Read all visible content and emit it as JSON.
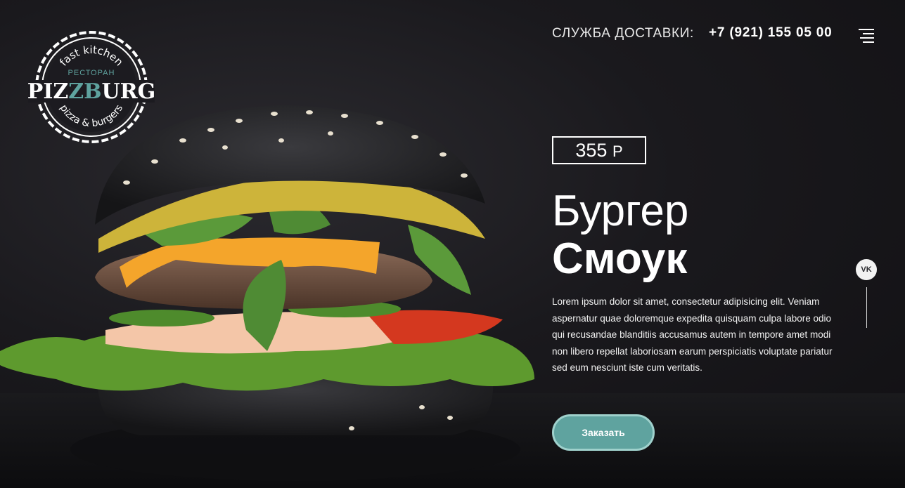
{
  "logo": {
    "top_text": "fast kitchen",
    "sub_text": "РЕСТОРАН",
    "brand_left": "PIZ",
    "brand_mid": "ZB",
    "brand_right": "URG",
    "bottom_text": "pizza & burgers"
  },
  "header": {
    "delivery_label": "СЛУЖБА ДОСТАВКИ:",
    "phone": "+7 (921) 155 05 00",
    "menu_icon": "hamburger-menu-icon"
  },
  "product": {
    "price_value": "355",
    "price_currency": "Р",
    "title_line1": "Бургер",
    "title_line2": "Смоук",
    "description": "Lorem ipsum dolor sit amet, consectetur adipisicing elit. Veniam aspernatur quae doloremque expedita quisquam culpa labore odio qui recusandae blanditiis accusamus autem in tempore amet modi non libero repellat laboriosam earum perspiciatis voluptate pariatur sed eum nesciunt iste cum veritatis.",
    "order_button": "Заказать"
  },
  "social": {
    "vk_label": "VK",
    "vk_icon": "vk-icon"
  },
  "colors": {
    "accent": "#5fa39f",
    "accent_border": "#9fd1cc",
    "background": "#1a191d"
  }
}
